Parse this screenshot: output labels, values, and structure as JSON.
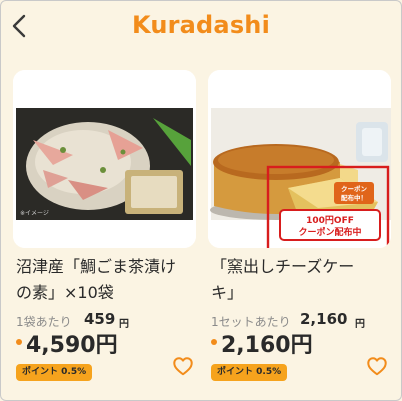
{
  "header": {
    "logo_text": "Kuradashi"
  },
  "products": [
    {
      "title_line1": "沼津産「鯛ごま茶漬け",
      "title_line2": "の素」×10袋",
      "per_unit_label": "1袋あたり",
      "per_unit_value": "459",
      "per_unit_yen": "円",
      "price": "4,590円",
      "points": "ポイント 0.5%",
      "image_caption": "※イメージ"
    },
    {
      "title_line1": "「窯出しチーズケー",
      "title_line2": "キ」",
      "per_unit_label": "1セットあたり",
      "per_unit_value": "2,160",
      "per_unit_yen": "円",
      "price": "2,160円",
      "points": "ポイント 0.5%",
      "coupon_tag_line1": "クーポン",
      "coupon_tag_line2": "配布中！",
      "coupon_banner_line1": "100円OFF",
      "coupon_banner_line2": "クーポン配布中"
    }
  ],
  "colors": {
    "accent": "#f28c1b",
    "background": "#fbf4e3",
    "coupon_red": "#d81d1d"
  }
}
